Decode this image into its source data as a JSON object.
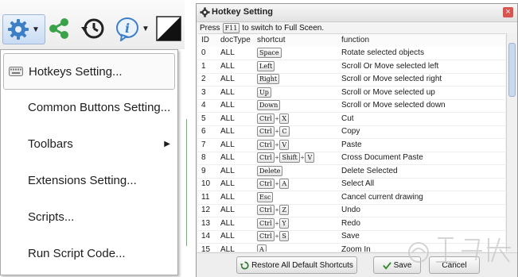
{
  "menu": {
    "items": [
      {
        "label": "Hotkeys Setting..."
      },
      {
        "label": "Common Buttons Setting..."
      },
      {
        "label": "Toolbars"
      },
      {
        "label": "Extensions Setting..."
      },
      {
        "label": "Scripts..."
      },
      {
        "label": "Run Script Code..."
      }
    ]
  },
  "dialog": {
    "title": "Hotkey Setting",
    "close_label": "×",
    "hint_before": "Press",
    "hint_key": "F11",
    "hint_after": "to switch to Full Sceen.",
    "columns": {
      "id": "ID",
      "doctype": "docType",
      "shortcut": "shortcut",
      "function": "function"
    },
    "rows": [
      {
        "id": "0",
        "doc": "ALL",
        "keys": [
          "Space"
        ],
        "fn": "Rotate selected objects"
      },
      {
        "id": "1",
        "doc": "ALL",
        "keys": [
          "Left"
        ],
        "fn": "Scroll Or Move selected left"
      },
      {
        "id": "2",
        "doc": "ALL",
        "keys": [
          "Right"
        ],
        "fn": "Scroll or Move selected right"
      },
      {
        "id": "3",
        "doc": "ALL",
        "keys": [
          "Up"
        ],
        "fn": "Scroll or Move selected up"
      },
      {
        "id": "4",
        "doc": "ALL",
        "keys": [
          "Down"
        ],
        "fn": "Scroll or Move selected down"
      },
      {
        "id": "5",
        "doc": "ALL",
        "keys": [
          "Ctrl",
          "X"
        ],
        "fn": "Cut"
      },
      {
        "id": "6",
        "doc": "ALL",
        "keys": [
          "Ctrl",
          "C"
        ],
        "fn": "Copy"
      },
      {
        "id": "7",
        "doc": "ALL",
        "keys": [
          "Ctrl",
          "V"
        ],
        "fn": "Paste"
      },
      {
        "id": "8",
        "doc": "ALL",
        "keys": [
          "Ctrl",
          "Shift",
          "V"
        ],
        "fn": "Cross Document Paste"
      },
      {
        "id": "9",
        "doc": "ALL",
        "keys": [
          "Delete"
        ],
        "fn": "Delete Selected"
      },
      {
        "id": "10",
        "doc": "ALL",
        "keys": [
          "Ctrl",
          "A"
        ],
        "fn": "Select All"
      },
      {
        "id": "11",
        "doc": "ALL",
        "keys": [
          "Esc"
        ],
        "fn": "Cancel current drawing"
      },
      {
        "id": "12",
        "doc": "ALL",
        "keys": [
          "Ctrl",
          "Z"
        ],
        "fn": "Undo"
      },
      {
        "id": "13",
        "doc": "ALL",
        "keys": [
          "Ctrl",
          "Y"
        ],
        "fn": "Redo"
      },
      {
        "id": "14",
        "doc": "ALL",
        "keys": [
          "Ctrl",
          "S"
        ],
        "fn": "Save"
      },
      {
        "id": "15",
        "doc": "ALL",
        "keys": [
          "A"
        ],
        "fn": "Zoom In"
      }
    ],
    "buttons": {
      "restore": "Restore All Default Shortcuts",
      "save": "Save",
      "cancel": "Cancel"
    }
  },
  "colors": {
    "accent": "#3d7fc6",
    "close": "#d9534f",
    "share_green": "#3aa34a"
  }
}
